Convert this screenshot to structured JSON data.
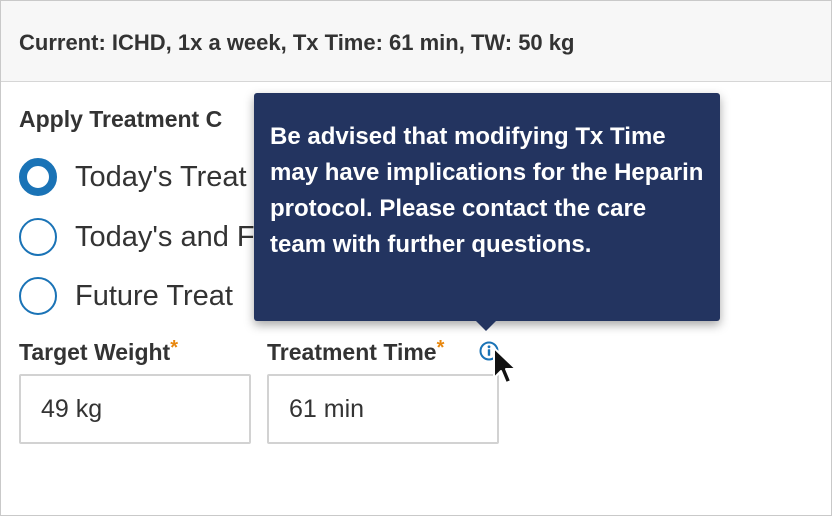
{
  "header": {
    "current_summary": "Current: ICHD, 1x a week, Tx Time: 61 min, TW: 50 kg"
  },
  "apply_section": {
    "title": "Apply Treatment C",
    "options": [
      {
        "label": "Today's Treat",
        "checked": true
      },
      {
        "label": "Today's and F",
        "checked": false
      },
      {
        "label": "Future Treat",
        "checked": false
      }
    ]
  },
  "fields": {
    "target_weight": {
      "label": "Target Weight",
      "required_mark": "*",
      "value": "49 kg"
    },
    "treatment_time": {
      "label": "Treatment Time",
      "required_mark": "*",
      "value": "61 min"
    }
  },
  "tooltip": {
    "text": "Be advised that modifying Tx Time may have implications for the Heparin protocol. Please contact the care team with further questions."
  },
  "icons": {
    "info": "info-icon",
    "cursor": "mouse-pointer-icon"
  },
  "colors": {
    "accent": "#1a73b6",
    "required": "#e8870e",
    "tooltip_bg": "#233460",
    "header_bg": "#f7f7f7"
  }
}
